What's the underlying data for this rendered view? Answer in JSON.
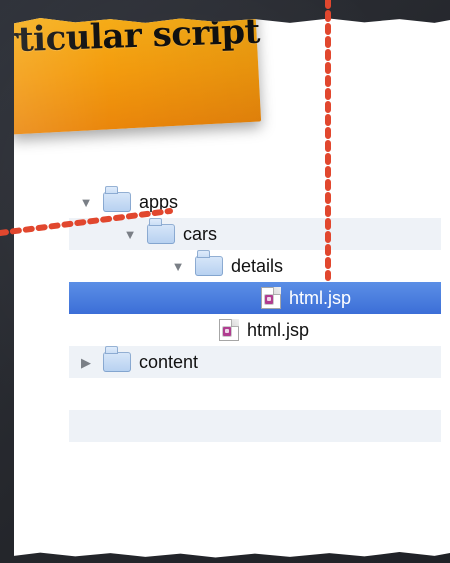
{
  "note": {
    "text": "rticular script"
  },
  "tree": {
    "rows": [
      {
        "label": "apps",
        "kind": "folder",
        "expanded": true
      },
      {
        "label": "cars",
        "kind": "folder",
        "expanded": true
      },
      {
        "label": "details",
        "kind": "folder",
        "expanded": true
      },
      {
        "label": "html.jsp",
        "kind": "file",
        "selected": true
      },
      {
        "label": "html.jsp",
        "kind": "file"
      },
      {
        "label": "content",
        "kind": "folder",
        "expanded": false
      }
    ]
  },
  "colors": {
    "sticky": "#f39b0e",
    "selection": "#3c6ed7",
    "callout": "#e1472e",
    "stripe": "#eef2f7"
  },
  "icons": {
    "expanded": "triangle-down",
    "collapsed": "triangle-right",
    "folder": "folder",
    "file": "jsp-file"
  }
}
